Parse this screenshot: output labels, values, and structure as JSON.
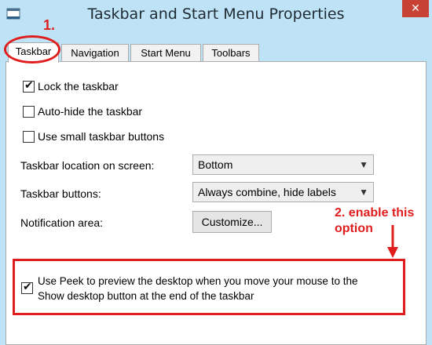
{
  "window": {
    "title": "Taskbar and Start Menu Properties",
    "close_glyph": "✕",
    "app_icon": "window-icon"
  },
  "annotations": {
    "step1": "1.",
    "step2_line1": "2. enable this",
    "step2_line2": "option"
  },
  "tabs": [
    {
      "label": "Taskbar",
      "active": true
    },
    {
      "label": "Navigation",
      "active": false
    },
    {
      "label": "Start Menu",
      "active": false
    },
    {
      "label": "Toolbars",
      "active": false
    }
  ],
  "options": {
    "lock_taskbar": {
      "label": "Lock the taskbar",
      "checked": true
    },
    "auto_hide": {
      "label": "Auto-hide the taskbar",
      "checked": false
    },
    "small_buttons": {
      "label": "Use small taskbar buttons",
      "checked": false
    },
    "location": {
      "label": "Taskbar location on screen:",
      "value": "Bottom"
    },
    "buttons": {
      "label": "Taskbar buttons:",
      "value": "Always combine, hide labels"
    },
    "notification": {
      "label": "Notification area:",
      "button": "Customize..."
    },
    "peek": {
      "line1": "Use Peek to preview the desktop when you move your mouse to the",
      "line2": "Show desktop button at the end of the taskbar",
      "checked": true
    }
  },
  "colors": {
    "accent": "#e01d1d",
    "titlebar": "#bfe3f6",
    "close": "#c74135"
  }
}
